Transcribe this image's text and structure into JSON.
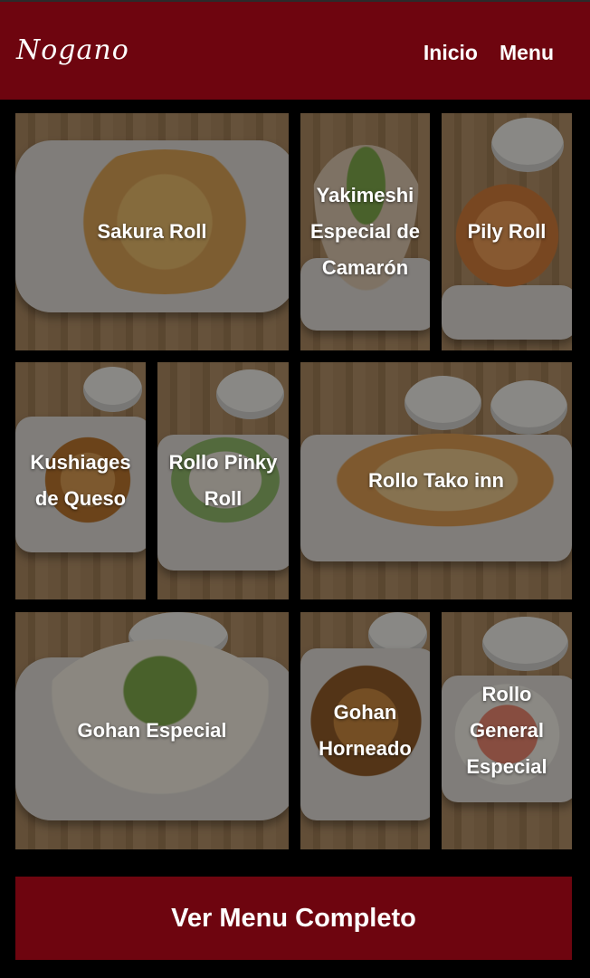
{
  "header": {
    "logo": "Nogano",
    "nav": [
      "Inicio",
      "Menu"
    ]
  },
  "dishes": [
    {
      "label": "Sakura Roll"
    },
    {
      "label": "Yakimeshi Especial de Camarón"
    },
    {
      "label": "Pily Roll"
    },
    {
      "label": "Kushiages de Queso"
    },
    {
      "label": "Rollo Pinky Roll"
    },
    {
      "label": "Rollo Tako inn"
    },
    {
      "label": "Gohan Especial"
    },
    {
      "label": "Gohan Horneado"
    },
    {
      "label": "Rollo General Especial"
    }
  ],
  "cta": {
    "label": "Ver Menu Completo"
  },
  "colors": {
    "brand": "#6e050f",
    "background": "#000000"
  }
}
